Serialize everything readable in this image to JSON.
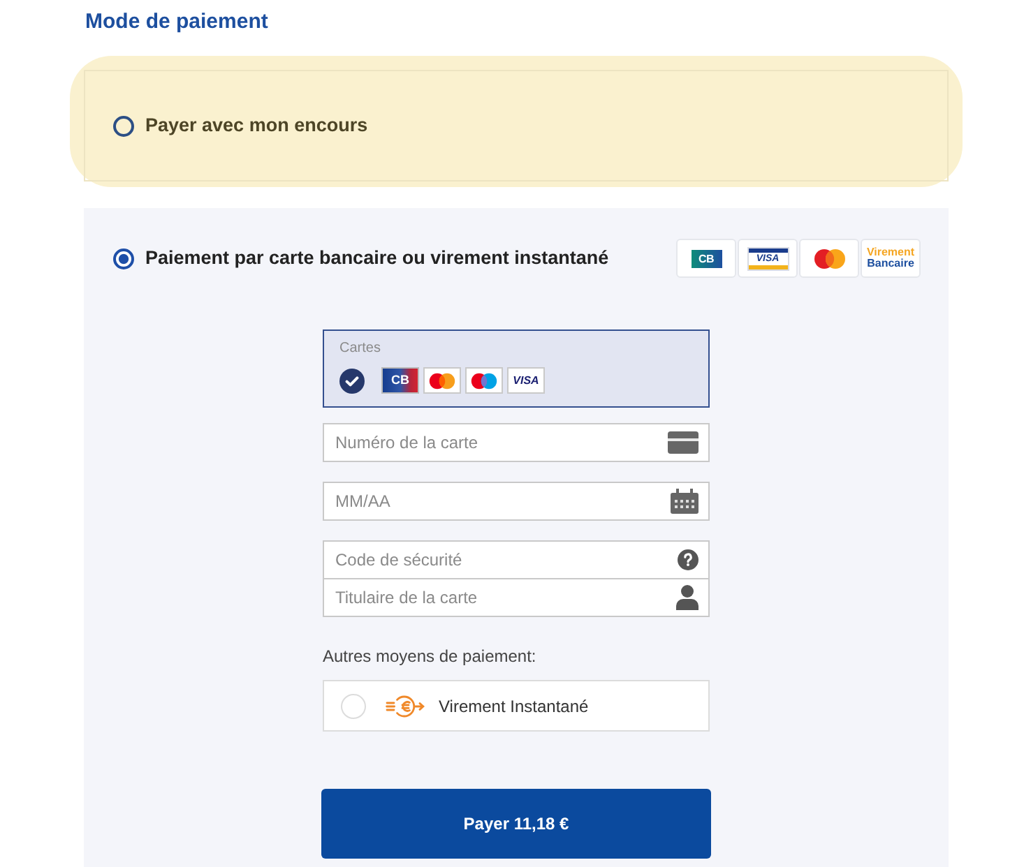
{
  "section_title": "Mode de paiement",
  "options": [
    {
      "kind": "plain",
      "label": "Payer avec mon encours",
      "selected": false,
      "highlighted": true
    },
    {
      "kind": "card",
      "label": "Paiement par carte bancaire ou virement instantané",
      "selected": true,
      "highlighted": false,
      "logos": [
        {
          "kind": "cb",
          "text": "CB"
        },
        {
          "kind": "visa",
          "text": "VISA"
        },
        {
          "kind": "mastercard"
        },
        {
          "kind": "transfer",
          "lines": [
            "Virement",
            "Bancaire"
          ]
        }
      ],
      "card_types": {
        "label": "Cartes",
        "checked": true,
        "logos": [
          {
            "kind": "cb",
            "text": "CB"
          },
          {
            "kind": "mastercard"
          },
          {
            "kind": "maestro"
          },
          {
            "kind": "visa",
            "text": "VISA"
          }
        ]
      },
      "field_groups": [
        {
          "fields": [
            {
              "kind": "card",
              "placeholder": "Numéro de la carte"
            }
          ]
        },
        {
          "fields": [
            {
              "kind": "calendar",
              "placeholder": "MM/AA"
            }
          ]
        },
        {
          "fields": [
            {
              "kind": "help",
              "placeholder": "Code de sécurité"
            },
            {
              "kind": "person",
              "placeholder": "Titulaire de la carte"
            }
          ]
        }
      ],
      "other_methods": {
        "label": "Autres moyens de paiement:",
        "items": [
          {
            "label": "Virement Instantané",
            "selected": false
          }
        ]
      },
      "pay_button": "Payer 11,18 €"
    }
  ]
}
